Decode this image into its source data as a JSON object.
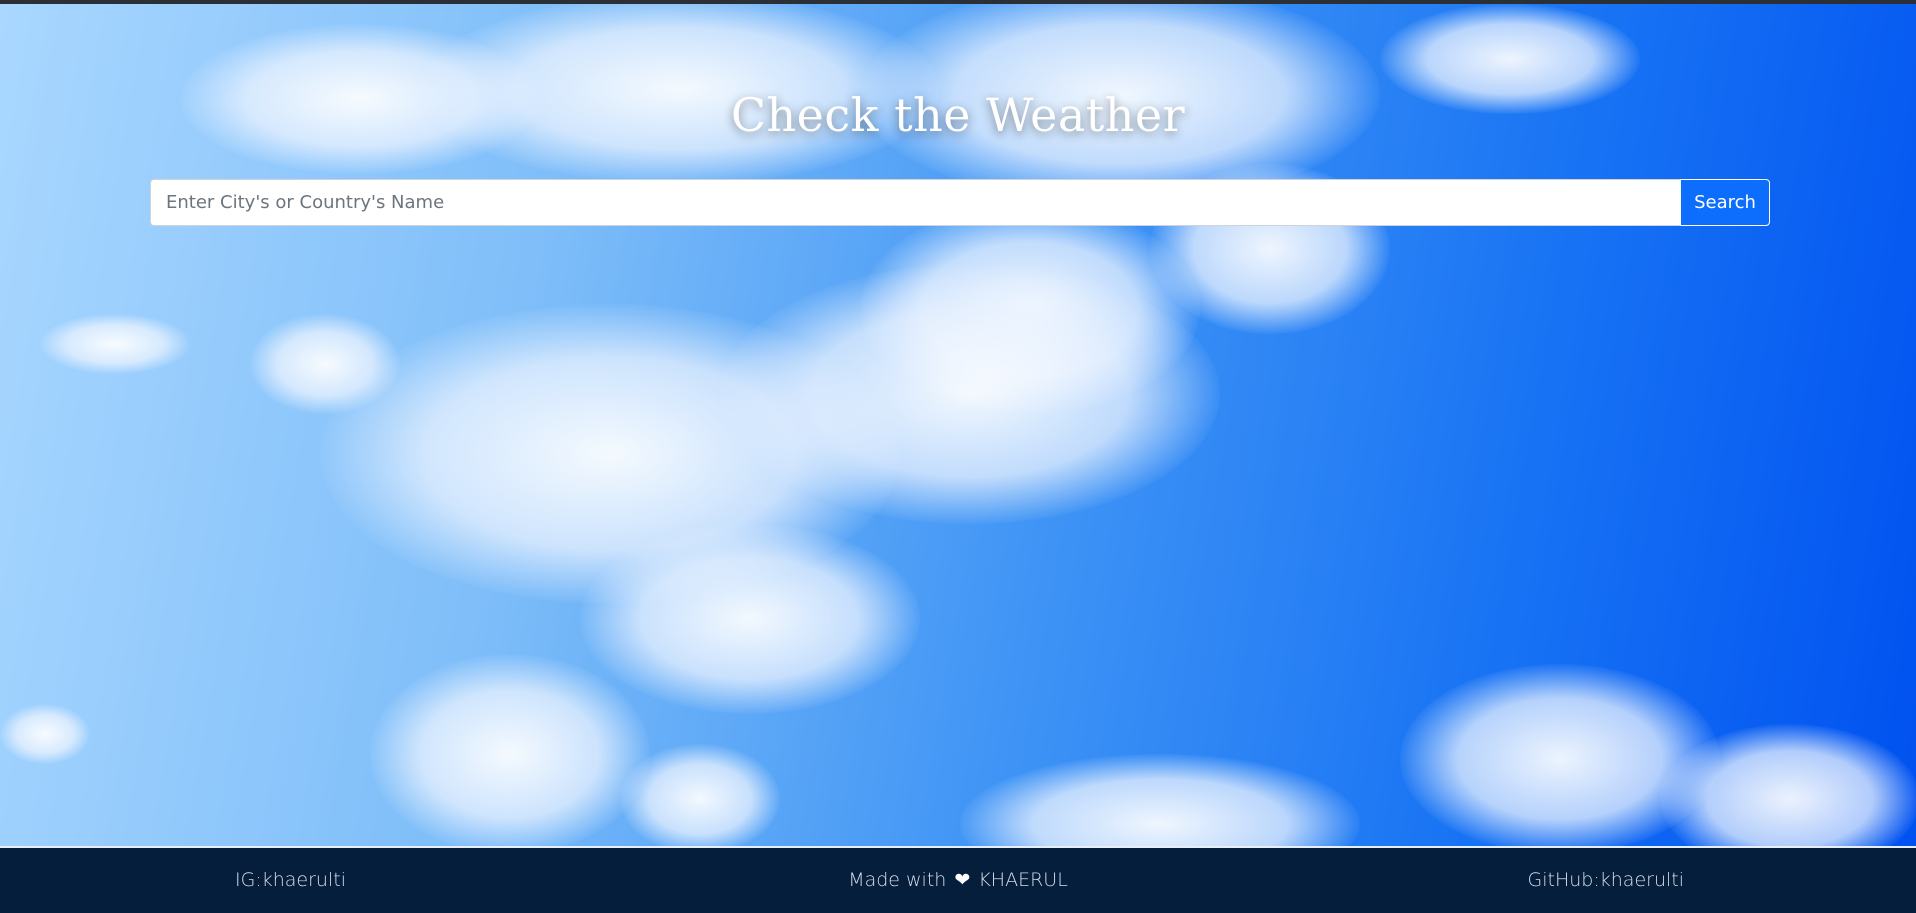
{
  "header": {
    "title": "Check the Weather"
  },
  "search": {
    "placeholder": "Enter City's or Country's Name",
    "value": "",
    "button_label": "Search"
  },
  "footer": {
    "left_link": "IG:khaerulti",
    "center_prefix": "Made with",
    "center_icon": "heart-icon",
    "center_suffix": "KHAERUL",
    "right_link": "GitHub:khaerulti"
  },
  "colors": {
    "button": "#0d6efd",
    "footer_bg": "#051e3c",
    "sky_light": "#a9d7ff",
    "sky_dark": "#0051f0"
  }
}
